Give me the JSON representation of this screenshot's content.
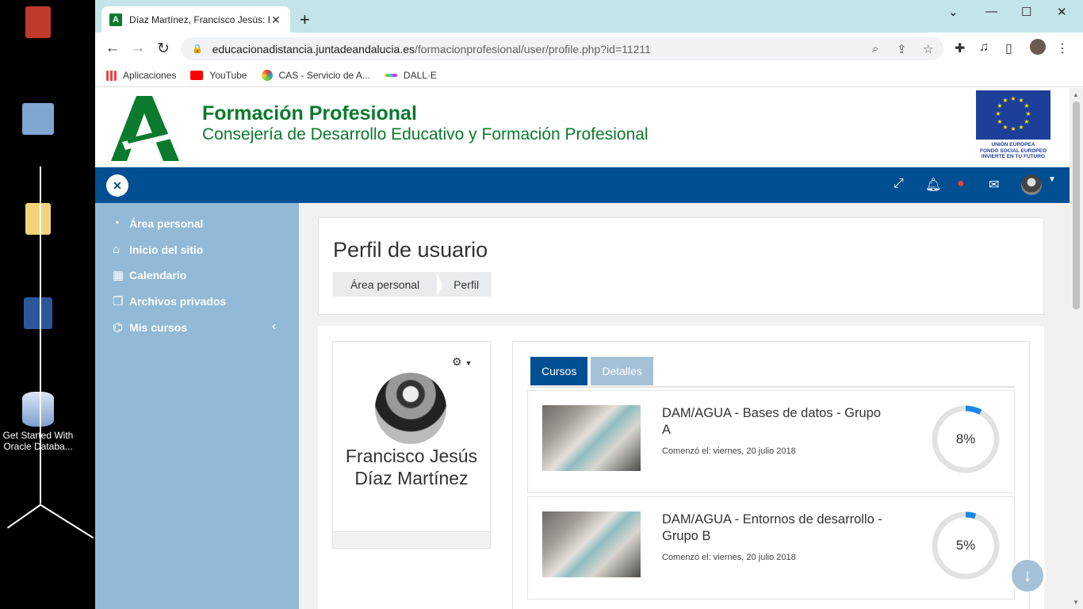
{
  "desktop": {
    "icons": [
      {
        "name": "recycle-bin-icon"
      },
      {
        "name": "network-icon"
      },
      {
        "name": "folder-icon"
      },
      {
        "name": "word-icon"
      }
    ],
    "oracle_label": "Get Started With Oracle Databa..."
  },
  "browser": {
    "tab_title": "Díaz Martínez, Francisco Jesús: Pe",
    "url_host": "educacionadistancia.juntadeandalucia.es",
    "url_path": "/formacionprofesional/user/profile.php?id=11211",
    "bookmarks": [
      "Aplicaciones",
      "YouTube",
      "CAS - Servicio de A...",
      "DALL·E"
    ]
  },
  "header": {
    "title": "Formación Profesional",
    "subtitle": "Consejería de Desarrollo Educativo y Formación Profesional",
    "eu_text": "UNIÓN EUROPEA\nFONDO SOCIAL EUROPEO\nINVIERTE EN TU FUTURO"
  },
  "drawer": {
    "items": [
      {
        "label": "Área personal",
        "icon": "dashboard-icon"
      },
      {
        "label": "Inicio del sitio",
        "icon": "home-icon"
      },
      {
        "label": "Calendario",
        "icon": "calendar-icon"
      },
      {
        "label": "Archivos privados",
        "icon": "files-icon"
      },
      {
        "label": "Mis cursos",
        "icon": "graduation-cap-icon"
      }
    ]
  },
  "page": {
    "title": "Perfil de usuario",
    "breadcrumb": [
      "Área personal",
      "Perfil"
    ]
  },
  "profile": {
    "name": "Francisco Jesús Díaz Martínez"
  },
  "tabs": [
    "Cursos",
    "Detalles"
  ],
  "courses": [
    {
      "name": "DAM/AGUA - Bases de datos - Grupo A",
      "date": "Comenzó el: viernes, 20 julio 2018",
      "progress": 8,
      "progress_label": "8%"
    },
    {
      "name": "DAM/AGUA - Entornos de desarrollo - Grupo B",
      "date": "Comenzó el: viernes, 20 julio 2018",
      "progress": 5,
      "progress_label": "5%"
    }
  ],
  "colors": {
    "green": "#0a7a2e",
    "navy": "#004f92",
    "drawer": "#92b9d5",
    "progress": "#1a87e6"
  }
}
